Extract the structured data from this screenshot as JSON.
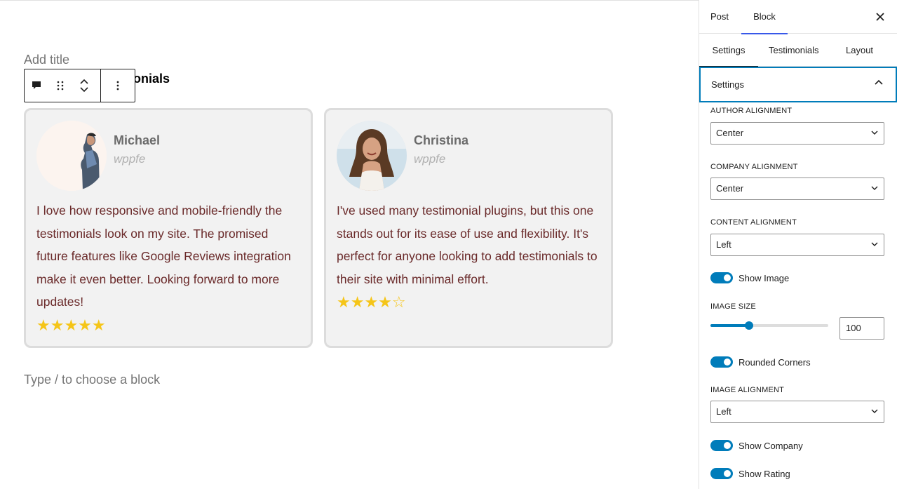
{
  "editor": {
    "title_placeholder": "Add title",
    "block_title": "onials",
    "appender_text": "Type / to choose a block"
  },
  "testimonials": [
    {
      "name": "Michael",
      "company": "wppfe",
      "text": "I love how responsive and mobile-friendly the testimonials look on my site. The promised future features like Google Reviews integration make it even better. Looking forward to more updates!",
      "rating": 5,
      "stars": "★★★★★"
    },
    {
      "name": "Christina",
      "company": "wppfe",
      "text": "I've used many testimonial plugins, but this one stands out for its ease of use and flexibility. It's perfect for anyone looking to add testimonials to their site with minimal effort.",
      "rating": 4,
      "stars": "★★★★☆"
    }
  ],
  "sidebar": {
    "tabs": {
      "post": "Post",
      "block": "Block"
    },
    "subtabs": {
      "settings": "Settings",
      "testimonials": "Testimonials",
      "layout": "Layout"
    },
    "panel_title": "Settings",
    "author_alignment": {
      "label": "AUTHOR ALIGNMENT",
      "value": "Center"
    },
    "company_alignment": {
      "label": "COMPANY ALIGNMENT",
      "value": "Center"
    },
    "content_alignment": {
      "label": "CONTENT ALIGNMENT",
      "value": "Left"
    },
    "show_image": {
      "label": "Show Image",
      "on": true
    },
    "image_size": {
      "label": "IMAGE SIZE",
      "value": "100",
      "slider_fraction": 0.33
    },
    "rounded_corners": {
      "label": "Rounded Corners",
      "on": true
    },
    "image_alignment": {
      "label": "IMAGE ALIGNMENT",
      "value": "Left"
    },
    "show_company": {
      "label": "Show Company",
      "on": true
    },
    "show_rating": {
      "label": "Show Rating",
      "on": true
    }
  },
  "colors": {
    "accent": "#007cba",
    "star": "#f5c518",
    "quote_text": "#6a2a2a",
    "card_bg": "#f2f2f2"
  }
}
